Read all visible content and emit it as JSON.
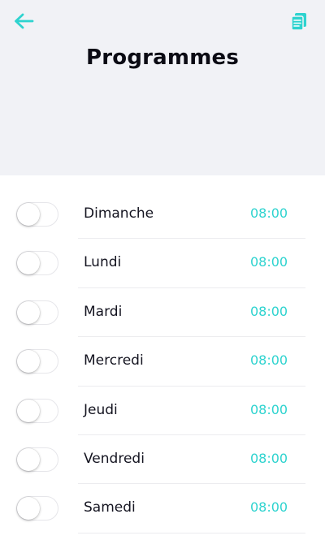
{
  "header": {
    "title": "Programmes",
    "back_icon": "arrow-left-icon",
    "right_icon": "notes-icon"
  },
  "colors": {
    "accent": "#2ed3cf",
    "header_bg": "#f1f2f6",
    "title": "#0b0b14",
    "text": "#141420"
  },
  "schedule": [
    {
      "day": "Dimanche",
      "time": "08:00",
      "enabled": false
    },
    {
      "day": "Lundi",
      "time": "08:00",
      "enabled": false
    },
    {
      "day": "Mardi",
      "time": "08:00",
      "enabled": false
    },
    {
      "day": "Mercredi",
      "time": "08:00",
      "enabled": false
    },
    {
      "day": "Jeudi",
      "time": "08:00",
      "enabled": false
    },
    {
      "day": "Vendredi",
      "time": "08:00",
      "enabled": false
    },
    {
      "day": "Samedi",
      "time": "08:00",
      "enabled": false
    }
  ]
}
